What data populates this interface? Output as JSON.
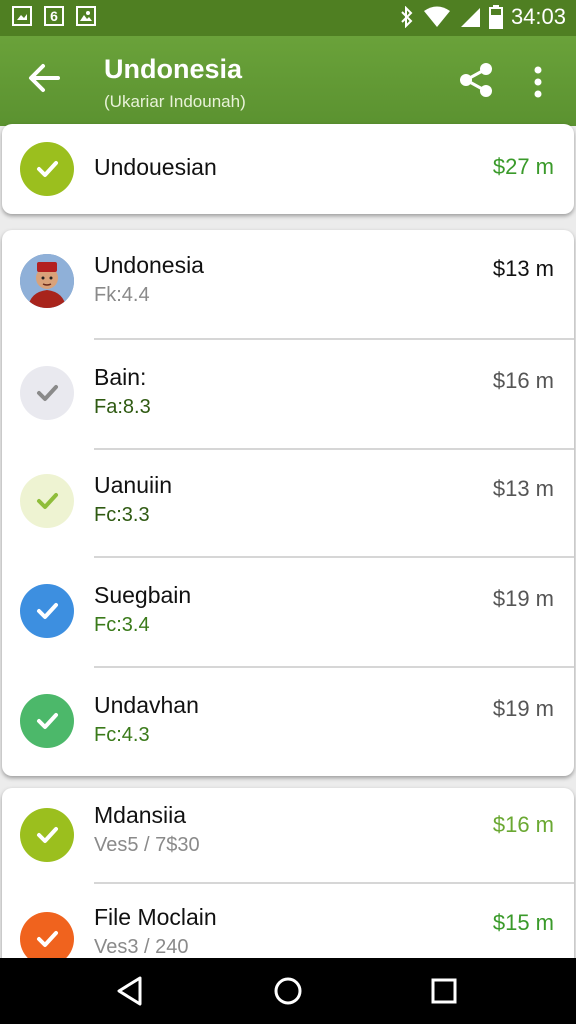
{
  "status": {
    "time": "34:03",
    "notif_digit": "6"
  },
  "header": {
    "title": "Undonesia",
    "subtitle": "(Ukariar Indounah)"
  },
  "top_item": {
    "name": "Undouesian",
    "price": "$27 m"
  },
  "items": [
    {
      "name": "Undonesia",
      "sub": "Fk:4.4",
      "price": "$13 m"
    },
    {
      "name": "Bain:",
      "sub": "Fa:8.3",
      "price": "$16 m"
    },
    {
      "name": "Uanuiin",
      "sub": "Fc:3.3",
      "price": "$13 m"
    },
    {
      "name": "Suegbain",
      "sub": "Fc:3.4",
      "price": "$19 m"
    },
    {
      "name": "Undavhan",
      "sub": "Fc:4.3",
      "price": "$19 m"
    }
  ],
  "bottom_items": [
    {
      "name": "Mdansiia",
      "sub": "Ves5 / 7$30",
      "price": "$16 m"
    },
    {
      "name": "File Moclain",
      "sub": "Ves3 / 240",
      "price": "$15 m"
    }
  ],
  "colors": {
    "appbar": "#5b9230",
    "statusbar": "#4f7f22",
    "check_lime": "#9bbf1e",
    "check_blue": "#3d8fe0",
    "check_green": "#4cb86a",
    "check_orange": "#f0631e",
    "price_green": "#3a9a2a"
  }
}
